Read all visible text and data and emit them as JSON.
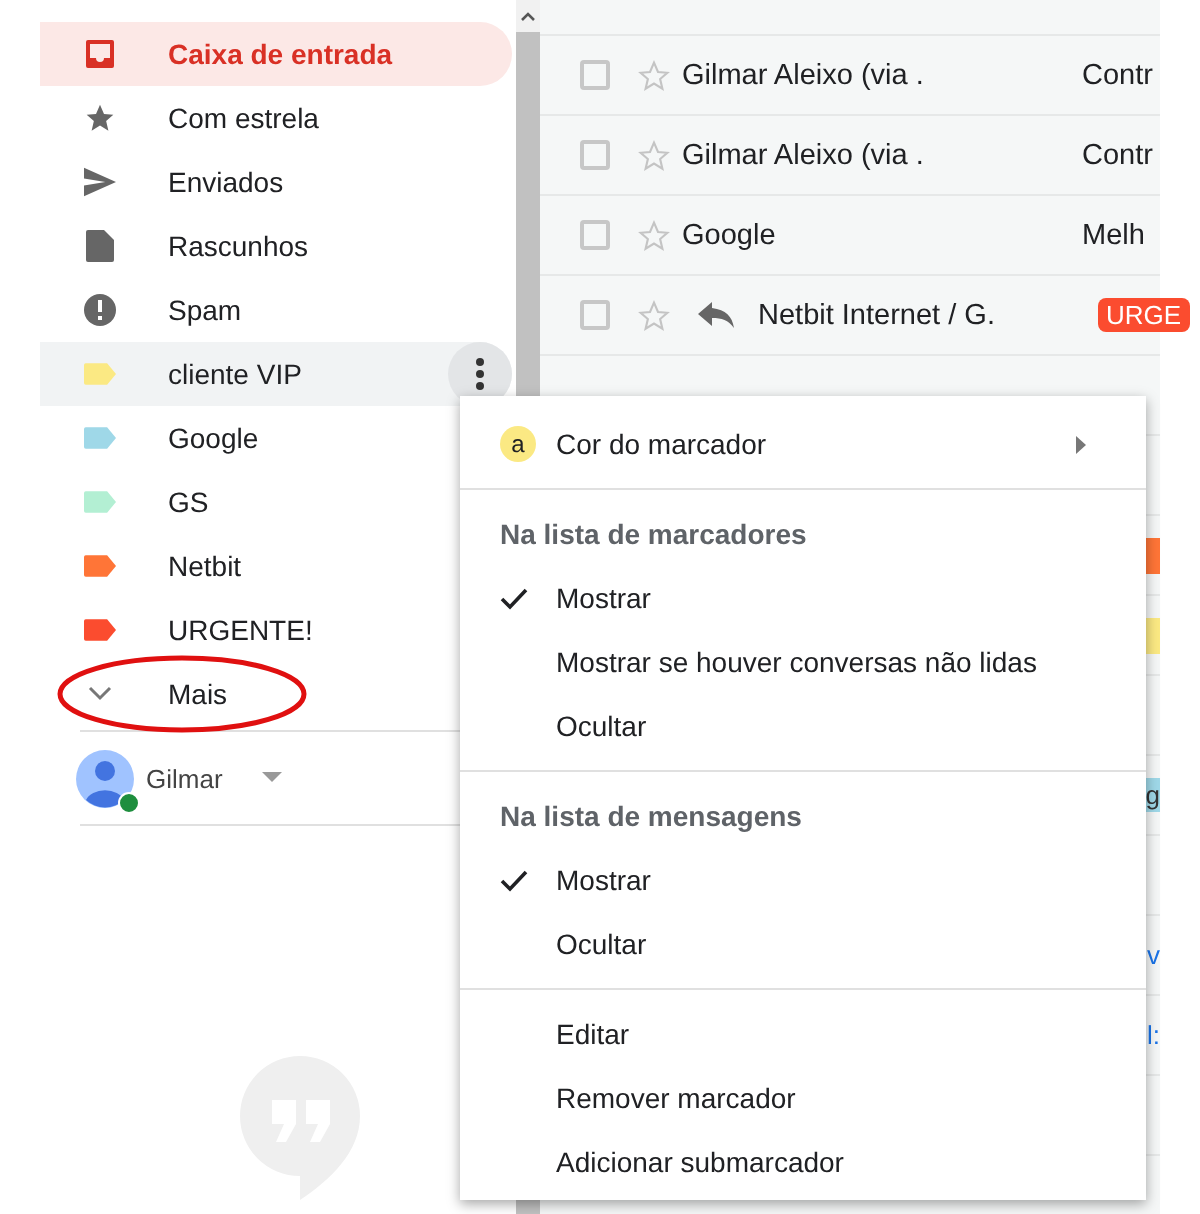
{
  "sidebar": {
    "items": [
      {
        "label": "Caixa de entrada",
        "kind": "folder",
        "selected": true,
        "hovered": false
      },
      {
        "label": "Com estrela",
        "kind": "folder",
        "selected": false,
        "hovered": false
      },
      {
        "label": "Enviados",
        "kind": "folder",
        "selected": false,
        "hovered": false
      },
      {
        "label": "Rascunhos",
        "kind": "folder",
        "selected": false,
        "hovered": false
      },
      {
        "label": "Spam",
        "kind": "folder",
        "selected": false,
        "hovered": false
      },
      {
        "label": "cliente VIP",
        "kind": "label",
        "color": "#fbe983",
        "selected": false,
        "hovered": true
      },
      {
        "label": "Google",
        "kind": "label",
        "color": "#9fd8e8",
        "selected": false,
        "hovered": false
      },
      {
        "label": "GS",
        "kind": "label",
        "color": "#b3efd3",
        "selected": false,
        "hovered": false
      },
      {
        "label": "Netbit",
        "kind": "label",
        "color": "#ff7537",
        "selected": false,
        "hovered": false
      },
      {
        "label": "URGENTE!",
        "kind": "label",
        "color": "#fb4c2f",
        "selected": false,
        "hovered": false
      }
    ],
    "more": {
      "label": "Mais",
      "circled": true
    },
    "account": {
      "name": "Gilmar",
      "online": true
    }
  },
  "mail_list": {
    "rows": [
      {},
      {
        "sender": "Gilmar Aleixo (via .",
        "checked": false,
        "replied": false,
        "subject": "Contr"
      },
      {
        "sender": "Gilmar Aleixo (via .",
        "checked": false,
        "replied": false,
        "subject": "Contr"
      },
      {
        "sender": "Google",
        "checked": false,
        "replied": false,
        "subject": "Melh"
      },
      {
        "sender": "Netbit Internet / G.",
        "checked": false,
        "replied": true,
        "tag": {
          "text": "URGE",
          "color": "#fb4c2f"
        }
      },
      {},
      {},
      {
        "tail": {
          "color": "#ff7537"
        }
      },
      {
        "tail": {
          "color": "#fbe983"
        }
      },
      {},
      {
        "tail": {
          "text": "g",
          "color": "#9fd8e8"
        }
      },
      {},
      {
        "tail": {
          "text": "v"
        }
      },
      {
        "tail": {
          "text": "l:"
        }
      },
      {}
    ]
  },
  "context_menu": {
    "color_item": {
      "badge": "a",
      "label": "Cor do marcador"
    },
    "sections": [
      {
        "header": "Na lista de marcadores",
        "options": [
          {
            "label": "Mostrar",
            "checked": true
          },
          {
            "label": "Mostrar se houver conversas não lidas",
            "checked": false
          },
          {
            "label": "Ocultar",
            "checked": false
          }
        ]
      },
      {
        "header": "Na lista de mensagens",
        "options": [
          {
            "label": "Mostrar",
            "checked": true
          },
          {
            "label": "Ocultar",
            "checked": false
          }
        ]
      }
    ],
    "actions": [
      "Editar",
      "Remover marcador",
      "Adicionar submarcador"
    ]
  }
}
